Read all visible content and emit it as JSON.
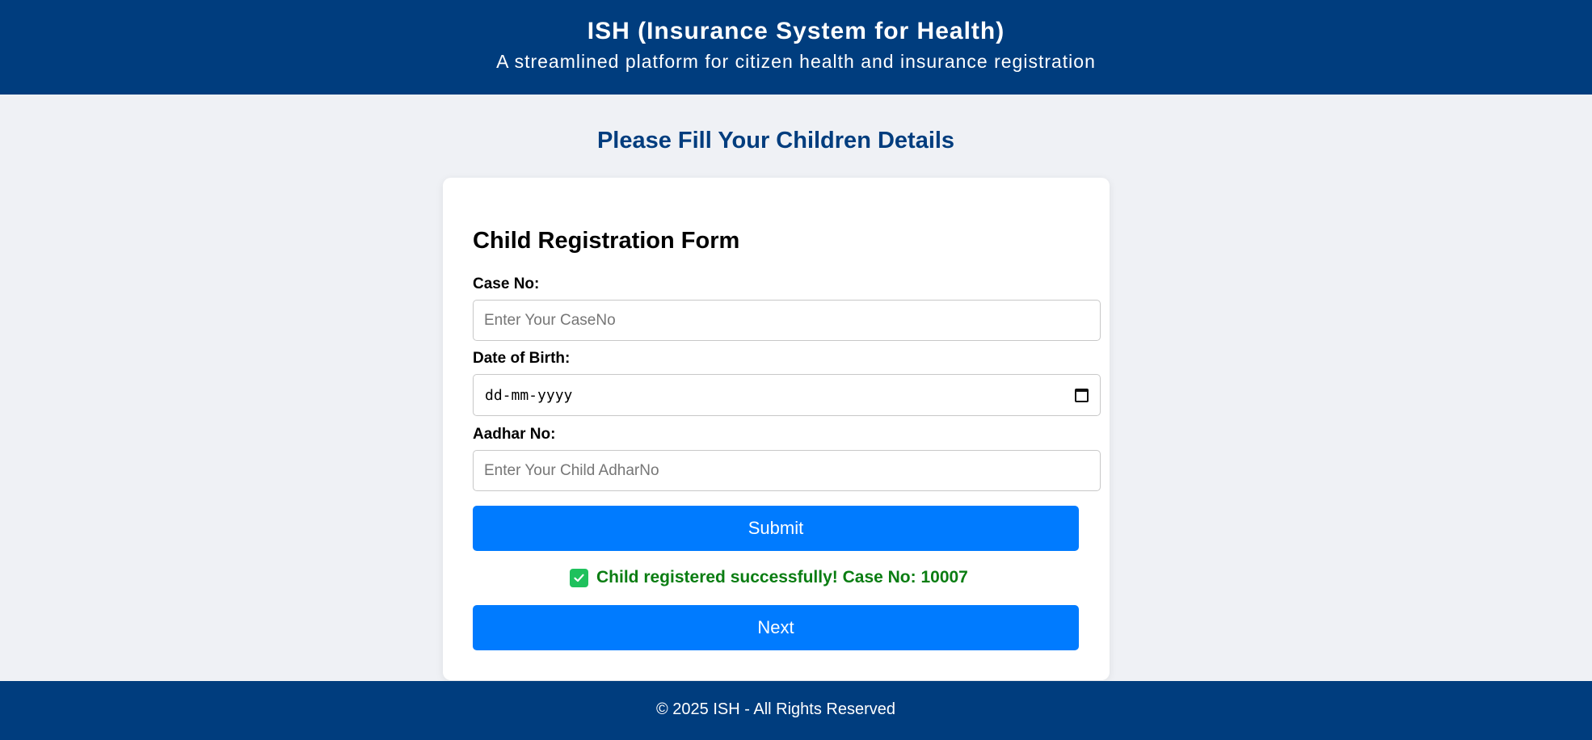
{
  "header": {
    "title": "ISH (Insurance System for Health)",
    "tagline": "A streamlined platform for citizen health and insurance registration"
  },
  "page_heading": "Please Fill Your Children Details",
  "form": {
    "title": "Child Registration Form",
    "case_no": {
      "label": "Case No:",
      "placeholder": "Enter Your CaseNo",
      "value": ""
    },
    "dob": {
      "label": "Date of Birth:",
      "placeholder": "dd-mm-yyyy",
      "icon": "calendar-icon"
    },
    "aadhar_no": {
      "label": "Aadhar No:",
      "placeholder": "Enter Your Child AdharNo",
      "value": ""
    },
    "submit_label": "Submit",
    "success_message": "Child registered successfully! Case No: 10007",
    "success_icon": "check-icon",
    "next_label": "Next"
  },
  "footer": {
    "text": "© 2025 ISH - All Rights Reserved"
  },
  "colors": {
    "brand": "#003d7e",
    "button": "#007bff",
    "success": "#0a7d12",
    "success_icon": "#1fc15d",
    "background": "#eff1f5"
  }
}
